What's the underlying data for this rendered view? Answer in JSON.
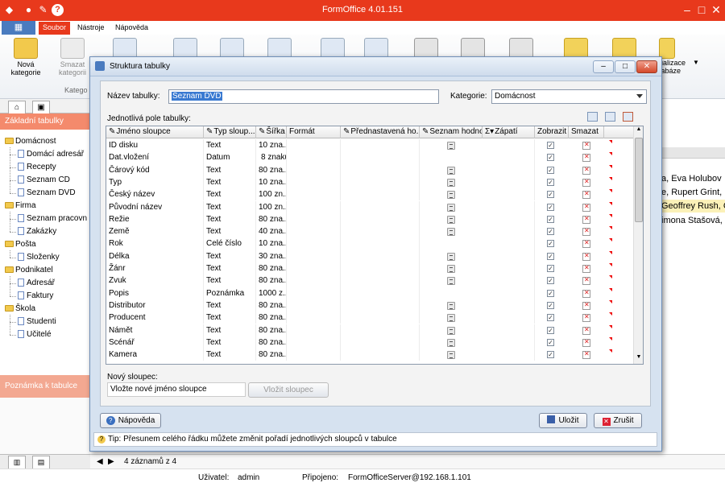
{
  "app": {
    "title": "FormOffice 4.01.151"
  },
  "menu": {
    "tabs": [
      "Soubor",
      "Nástroje",
      "Nápověda"
    ]
  },
  "ribbon": {
    "new_category": "Nová kategorie",
    "delete_category": "Smazat kategorii",
    "group_label": "Katego",
    "refresh_label_line1": "ualizace",
    "refresh_label_line2": "tabáze"
  },
  "sidebar": {
    "header": "Základní tabulky",
    "tree": [
      {
        "label": "Domácnost",
        "type": "folder"
      },
      {
        "label": "Domácí adresář",
        "type": "table"
      },
      {
        "label": "Recepty",
        "type": "table"
      },
      {
        "label": "Seznam CD",
        "type": "table"
      },
      {
        "label": "Seznam DVD",
        "type": "table"
      },
      {
        "label": "Firma",
        "type": "folder"
      },
      {
        "label": "Seznam pracovn",
        "type": "table"
      },
      {
        "label": "Zakázky",
        "type": "table"
      },
      {
        "label": "Pošta",
        "type": "folder"
      },
      {
        "label": "Složenky",
        "type": "table"
      },
      {
        "label": "Podnikatel",
        "type": "folder"
      },
      {
        "label": "Adresář",
        "type": "table"
      },
      {
        "label": "Faktury",
        "type": "table"
      },
      {
        "label": "Škola",
        "type": "folder"
      },
      {
        "label": "Studenti",
        "type": "table"
      },
      {
        "label": "Učitelé",
        "type": "table"
      }
    ],
    "note_header": "Poznámka k tabulce"
  },
  "background_rows": [
    "a, Eva  Holubov",
    "e, Rupert Grint, I",
    "Geoffrey Rush, C",
    "imona Stašová,"
  ],
  "navigation": {
    "records": "4 záznamů z 4"
  },
  "status": {
    "user_label": "Uživatel:",
    "user": "admin",
    "conn_label": "Připojeno:",
    "server": "FormOfficeServer@192.168.1.101"
  },
  "dialog": {
    "title": "Struktura tabulky",
    "table_name_label": "Název tabulky:",
    "table_name_value": "Seznam DVD",
    "category_label": "Kategorie:",
    "category_value": "Domácnost",
    "fields_label": "Jednotlivá pole tabulky:",
    "columns": [
      "Jméno sloupce",
      "Typ sloup...",
      "Šířka",
      "Formát",
      "Přednastavená ho...",
      "Seznam hodnot",
      "Zápatí",
      "Zobrazit",
      "Smazat"
    ],
    "rows": [
      {
        "name": "ID disku",
        "type": "Text",
        "width": "10 zna...",
        "list": true
      },
      {
        "name": "Dat.vložení",
        "type": "Datum",
        "width": "8 znaků",
        "list": false
      },
      {
        "name": "Čárový kód",
        "type": "Text",
        "width": "80 zna...",
        "list": true
      },
      {
        "name": "Typ",
        "type": "Text",
        "width": "10 zna...",
        "list": true
      },
      {
        "name": "Český název",
        "type": "Text",
        "width": "100 zn...",
        "list": true
      },
      {
        "name": "Původní název",
        "type": "Text",
        "width": "100 zn...",
        "list": true
      },
      {
        "name": "Režie",
        "type": "Text",
        "width": "80 zna...",
        "list": true
      },
      {
        "name": "Země",
        "type": "Text",
        "width": "40 zna...",
        "list": true
      },
      {
        "name": "Rok",
        "type": "Celé číslo",
        "width": "10 zna...",
        "list": false
      },
      {
        "name": "Délka",
        "type": "Text",
        "width": "30 zna...",
        "list": true
      },
      {
        "name": "Žánr",
        "type": "Text",
        "width": "80 zna...",
        "list": true
      },
      {
        "name": "Zvuk",
        "type": "Text",
        "width": "80 zna...",
        "list": true
      },
      {
        "name": "Popis",
        "type": "Poznámka",
        "width": "1000 z...",
        "list": false
      },
      {
        "name": "Distributor",
        "type": "Text",
        "width": "80 zna...",
        "list": true
      },
      {
        "name": "Producent",
        "type": "Text",
        "width": "80 zna...",
        "list": true
      },
      {
        "name": "Námět",
        "type": "Text",
        "width": "80 zna...",
        "list": true
      },
      {
        "name": "Scénář",
        "type": "Text",
        "width": "80 zna...",
        "list": true
      },
      {
        "name": "Kamera",
        "type": "Text",
        "width": "80 zna...",
        "list": true
      }
    ],
    "new_column_label": "Nový sloupec:",
    "new_column_value": "Vložte nové jméno sloupce",
    "insert_button": "Vložit sloupec",
    "help_button": "Nápověda",
    "save_button": "Uložit",
    "cancel_button": "Zrušit",
    "tip": "Tip: Přesunem celého řádku můžete změnit pořadí jednotlivých sloupců v tabulce"
  },
  "colors": {
    "title_bar": "#e8391c",
    "accent_orange": "#f48a6c",
    "dialog_frame": "#d6e2f0"
  }
}
